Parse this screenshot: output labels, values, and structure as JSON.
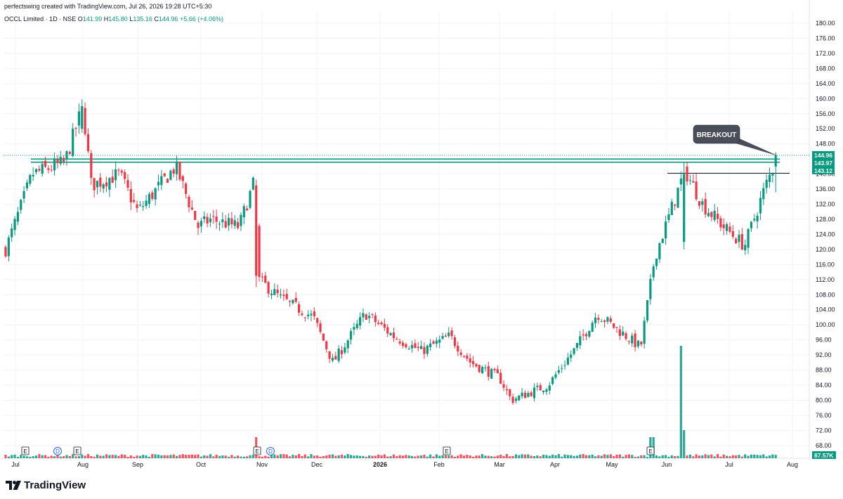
{
  "header": {
    "created_line": "perfectswing created with TradingView.com, Jul 26, 2026 19:28 UTC+5:30",
    "symbol": "OCCL Limited · 1D · NSE",
    "open_label": "O",
    "open": "141.99",
    "high_label": "H",
    "high": "145.80",
    "low_label": "L",
    "low": "135.16",
    "close_label": "C",
    "close": "144.96",
    "change": "+5.66 (+4.06%)"
  },
  "brand": {
    "name": "TradingView",
    "icon": "tradingview-logo-icon"
  },
  "colors": {
    "up": "#089981",
    "down": "#F23645",
    "level": "#089981",
    "grid": "#f0f3fa"
  },
  "chart_data": {
    "type": "candlestick",
    "y_axis": {
      "ylim": [
        66,
        182
      ],
      "ticks": [
        "180.00",
        "176.00",
        "172.00",
        "168.00",
        "164.00",
        "160.00",
        "156.00",
        "152.00",
        "148.00",
        "144.00",
        "140.00",
        "136.00",
        "132.00",
        "128.00",
        "124.00",
        "120.00",
        "116.00",
        "112.00",
        "108.00",
        "104.00",
        "100.00",
        "96.00",
        "92.00",
        "88.00",
        "84.00",
        "80.00",
        "76.00",
        "72.00",
        "68.00"
      ]
    },
    "x_axis": {
      "labels": [
        "Jul",
        "Aug",
        "Sep",
        "Oct",
        "Nov",
        "Dec",
        "2026",
        "Feb",
        "Mar",
        "Apr",
        "May",
        "Jun",
        "Jul",
        "Aug"
      ]
    },
    "price_badges": [
      {
        "value": "144.96",
        "price": 144.96,
        "color": "#089981"
      },
      {
        "value": "143.97",
        "price": 143.97,
        "color": "#089981"
      },
      {
        "value": "143.12",
        "price": 143.12,
        "color": "#089981"
      }
    ],
    "volume_badge": "87.57K",
    "horizontal_levels": [
      {
        "price": 144.96,
        "style": "dotted",
        "color": "#089981"
      },
      {
        "price": 143.97,
        "style": "solid",
        "color": "#089981"
      },
      {
        "price": 143.12,
        "style": "solid",
        "color": "#089981"
      }
    ],
    "resistance_line": {
      "price": 140.2,
      "from_label": "Jun",
      "to_label": "Aug",
      "color": "#131722"
    },
    "annotation": {
      "text": "BREAKOUT",
      "points_to_price": 144.96
    },
    "events": [
      {
        "symbol": "E",
        "month": "Jul"
      },
      {
        "symbol": "D",
        "month": "Jul"
      },
      {
        "symbol": "E",
        "month": "Aug"
      },
      {
        "symbol": "E",
        "month": "Nov"
      },
      {
        "symbol": "D",
        "month": "Nov"
      },
      {
        "symbol": "E",
        "month": "Feb"
      },
      {
        "symbol": "E",
        "month": "Jun"
      }
    ],
    "candle_anchors": [
      {
        "label": "Jul",
        "close": 120
      },
      {
        "label": "Jul",
        "close": 140
      },
      {
        "label": "Aug",
        "close": 143
      },
      {
        "label": "Aug",
        "close": 158
      },
      {
        "label": "Aug",
        "close": 137
      },
      {
        "label": "Sep",
        "close": 140
      },
      {
        "label": "Sep",
        "close": 130
      },
      {
        "label": "Sep",
        "close": 142
      },
      {
        "label": "Oct",
        "close": 126
      },
      {
        "label": "Oct",
        "close": 128
      },
      {
        "label": "Oct",
        "close": 126
      },
      {
        "label": "Nov",
        "close": 138
      },
      {
        "label": "Nov",
        "close": 112
      },
      {
        "label": "Nov",
        "close": 107
      },
      {
        "label": "Dec",
        "close": 102
      },
      {
        "label": "Dec",
        "close": 90
      },
      {
        "label": "2026",
        "close": 103
      },
      {
        "label": "2026",
        "close": 97
      },
      {
        "label": "Feb",
        "close": 93
      },
      {
        "label": "Feb",
        "close": 97
      },
      {
        "label": "Feb",
        "close": 90
      },
      {
        "label": "Mar",
        "close": 86
      },
      {
        "label": "Mar",
        "close": 80
      },
      {
        "label": "Apr",
        "close": 84
      },
      {
        "label": "Apr",
        "close": 94
      },
      {
        "label": "May",
        "close": 103
      },
      {
        "label": "May",
        "close": 94
      },
      {
        "label": "Jun",
        "close": 118
      },
      {
        "label": "Jun",
        "close": 141
      },
      {
        "label": "Jun",
        "close": 132
      },
      {
        "label": "Jul",
        "close": 126
      },
      {
        "label": "Jul",
        "close": 121
      },
      {
        "label": "Jul",
        "close": 137
      },
      {
        "label": "Aug",
        "close": 144.96
      }
    ]
  }
}
